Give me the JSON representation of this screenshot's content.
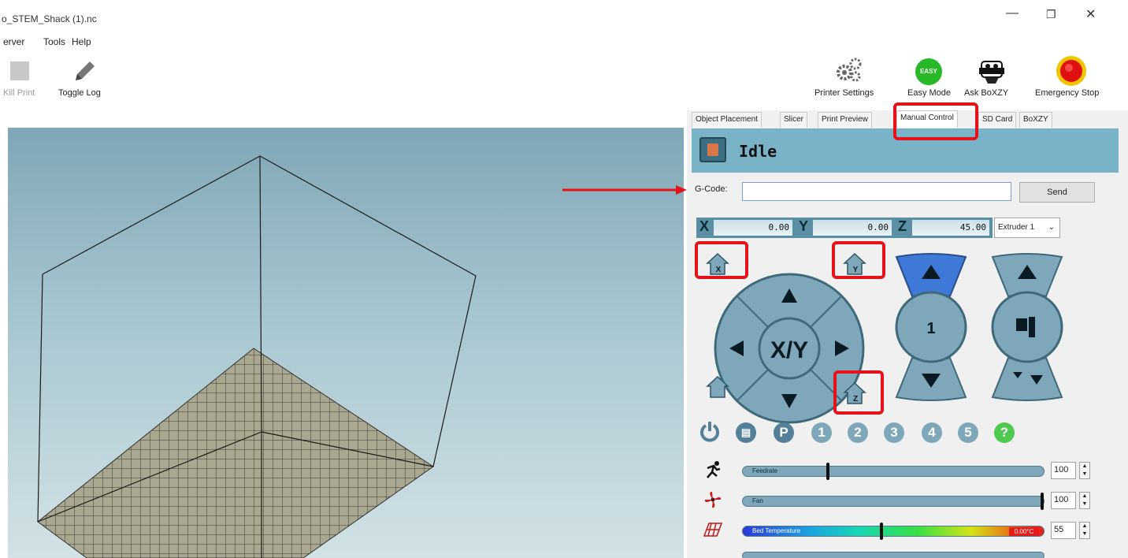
{
  "window": {
    "title": "o_STEM_Shack (1).nc",
    "minimize": "—",
    "maximize": "❐",
    "close": "✕"
  },
  "menu": [
    "erver",
    "Tools",
    "Help"
  ],
  "toolbar": {
    "kill_print": "Kill Print",
    "toggle_log": "Toggle Log",
    "printer_settings": "Printer Settings",
    "easy_mode": "Easy Mode",
    "easy_badge": "EASY",
    "ask_boxzy": "Ask BoXZY",
    "emergency_stop": "Emergency Stop"
  },
  "tabs": [
    "Object Placement",
    "Slicer",
    "Print Preview",
    "Manual Control",
    "SD Card",
    "BoXZY"
  ],
  "active_tab": "Manual Control",
  "status": {
    "text": "Idle"
  },
  "gcode": {
    "label": "G-Code:",
    "value": "",
    "send": "Send"
  },
  "coords": {
    "x_label": "X",
    "x": "0.00",
    "y_label": "Y",
    "y": "0.00",
    "z_label": "Z",
    "z": "45.00",
    "extruder": "Extruder 1"
  },
  "controls": {
    "xy_label": "X/Y",
    "z_step": "1",
    "home_x": "X",
    "home_y": "Y",
    "home_z": "Z"
  },
  "buttons_row": [
    "P",
    "1",
    "2",
    "3",
    "4",
    "5",
    "?"
  ],
  "sliders": {
    "feedrate": {
      "label": "Feedrate",
      "value": "100",
      "level": 0.28
    },
    "fan": {
      "label": "Fan",
      "value": "100",
      "level": 1.0
    },
    "bed": {
      "label": "Bed Temperature",
      "readout": "0.00°C",
      "value": "55",
      "level": 0.46
    }
  },
  "colors": {
    "accent_panel": "#7ab3c8",
    "highlight": "#e5121a",
    "control_blue": "#7ea8ba"
  },
  "icons": [
    "stop-square-icon",
    "pencil-icon",
    "gears-icon",
    "easy-mode-icon",
    "robot-icon",
    "emergency-stop-icon",
    "home-icon",
    "power-icon",
    "runner-icon",
    "fan-icon",
    "heatbed-icon"
  ]
}
